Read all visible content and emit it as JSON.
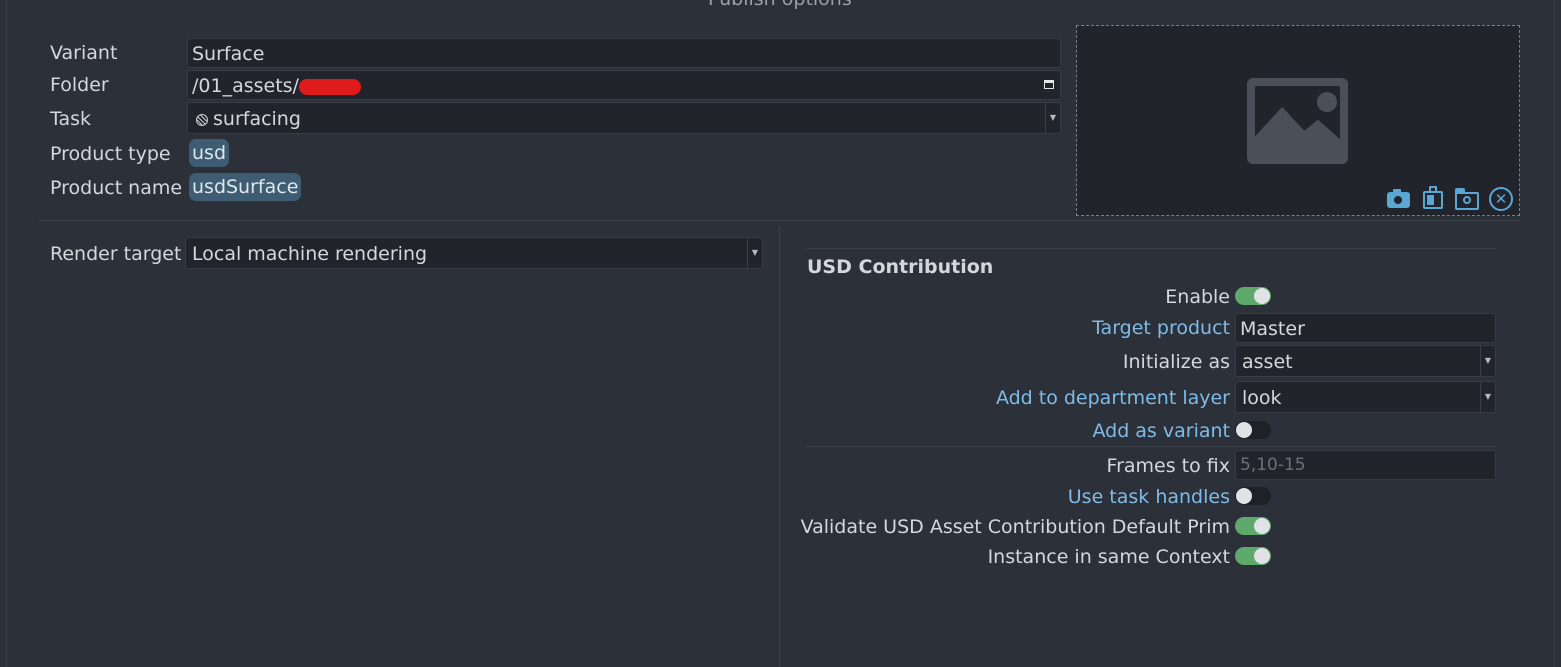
{
  "dialog": {
    "title": "Publish options"
  },
  "main": {
    "variant": {
      "label": "Variant",
      "value": "Surface"
    },
    "folder": {
      "label": "Folder",
      "value": "/01_assets/",
      "redacted_color": "#e01b1b"
    },
    "task": {
      "label": "Task",
      "value": "surfacing",
      "icon": "task-icon"
    },
    "product_type": {
      "label": "Product type",
      "value": "usd"
    },
    "product_name": {
      "label": "Product name",
      "value": "usdSurface"
    }
  },
  "thumbnail": {
    "placeholder_icon": "image-placeholder-icon",
    "buttons": [
      "camera-icon",
      "paste-icon",
      "browse-folder-icon",
      "clear-icon"
    ]
  },
  "render": {
    "label": "Render target",
    "value": "Local machine rendering"
  },
  "usd": {
    "section_title": "USD Contribution",
    "enable": {
      "label": "Enable",
      "on": true
    },
    "target_product": {
      "label": "Target product",
      "value": "Master"
    },
    "initialize_as": {
      "label": "Initialize as",
      "value": "asset"
    },
    "department_layer": {
      "label": "Add to department layer",
      "value": "look"
    },
    "add_as_variant": {
      "label": "Add as variant",
      "on": false
    },
    "frames_to_fix": {
      "label": "Frames to fix",
      "placeholder": "5,10-15"
    },
    "use_task_handles": {
      "label": "Use task handles",
      "on": false
    },
    "validate_default_prim": {
      "label": "Validate USD Asset Contribution Default Prim",
      "on": true
    },
    "instance_same_context": {
      "label": "Instance in same Context",
      "on": true
    }
  },
  "colors": {
    "background": "#2c3038",
    "field": "#21252b",
    "accent_link": "#7fbbe8",
    "tag": "#3e5d73",
    "toggle_on": "#5ea86c",
    "icon": "#5aa7d6"
  }
}
